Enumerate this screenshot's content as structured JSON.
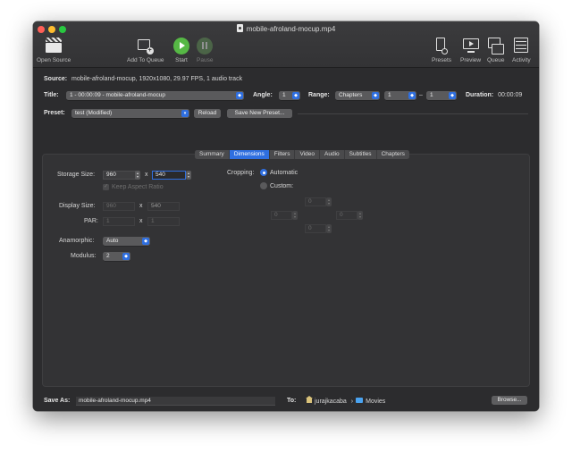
{
  "window": {
    "title": "mobile-afroland-mocup.mp4"
  },
  "toolbar": {
    "open_source": "Open Source",
    "add_to_queue": "Add To Queue",
    "start": "Start",
    "pause": "Pause",
    "presets": "Presets",
    "preview": "Preview",
    "queue": "Queue",
    "activity": "Activity"
  },
  "source": {
    "label": "Source:",
    "value": "mobile-afroland-mocup, 1920x1080, 29.97 FPS, 1 audio track"
  },
  "title_row": {
    "title_label": "Title:",
    "title_value": "1 - 00:00:09 - mobile-afroland-mocup",
    "angle_label": "Angle:",
    "angle_value": "1",
    "range_label": "Range:",
    "range_type": "Chapters",
    "range_start": "1",
    "range_sep": "–",
    "range_end": "1",
    "duration_label": "Duration:",
    "duration_value": "00:00:09"
  },
  "preset_row": {
    "label": "Preset:",
    "value": "test (Modified)",
    "reload": "Reload",
    "save_new": "Save New Preset..."
  },
  "tabs": [
    "Summary",
    "Dimensions",
    "Filters",
    "Video",
    "Audio",
    "Subtitles",
    "Chapters"
  ],
  "active_tab": "Dimensions",
  "dimensions": {
    "storage_label": "Storage Size:",
    "storage_w": "960",
    "storage_x": "x",
    "storage_h": "540",
    "keep_aspect": "Keep Aspect Ratio",
    "display_label": "Display Size:",
    "display_w": "960",
    "display_x": "x",
    "display_h": "540",
    "par_label": "PAR:",
    "par_w": "1",
    "par_x": "x",
    "par_h": "1",
    "anamorphic_label": "Anamorphic:",
    "anamorphic_value": "Auto",
    "modulus_label": "Modulus:",
    "modulus_value": "2",
    "cropping_label": "Cropping:",
    "crop_automatic": "Automatic",
    "crop_custom": "Custom:",
    "crop_top": "0",
    "crop_left": "0",
    "crop_right": "0",
    "crop_bottom": "0"
  },
  "footer": {
    "save_as_label": "Save As:",
    "save_as_value": "mobile-afroland-mocup.mp4",
    "to_label": "To:",
    "path_user": "jurajkacaba",
    "path_sep": "›",
    "path_folder": "Movies",
    "browse": "Browse..."
  },
  "colors": {
    "accent": "#2f6fe0",
    "start_green": "#56b845",
    "window_bg": "#2c2c2e"
  }
}
